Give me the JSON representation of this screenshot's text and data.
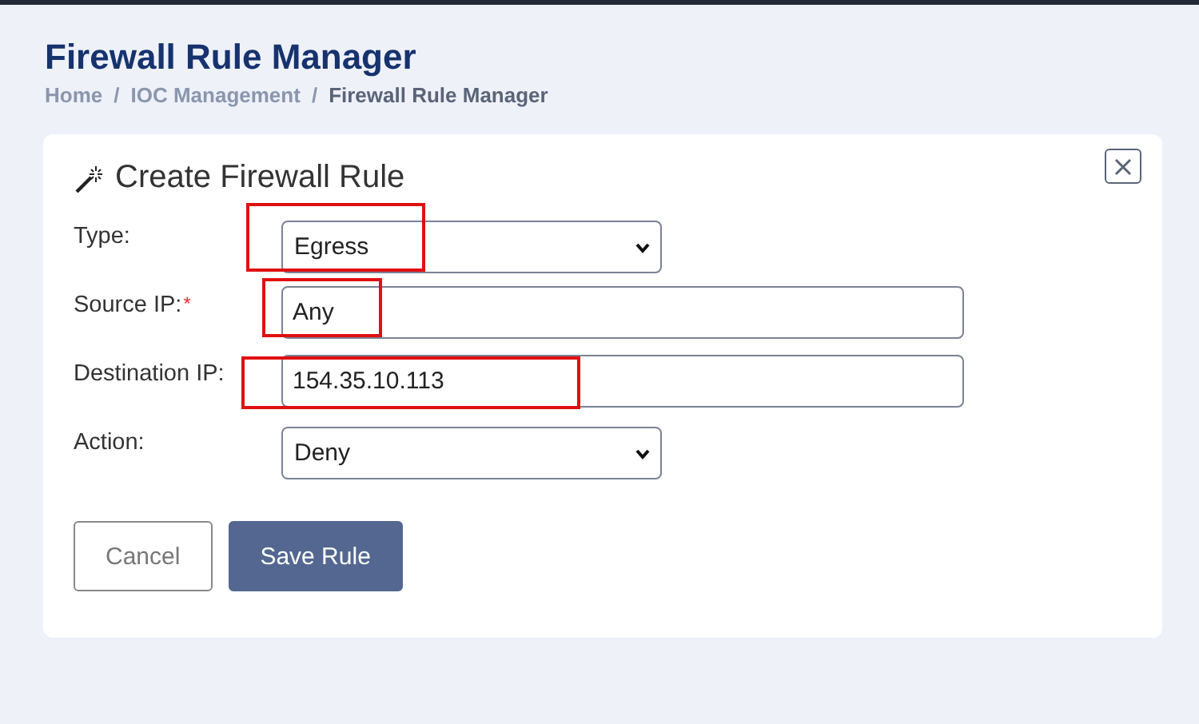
{
  "page": {
    "title": "Firewall Rule Manager"
  },
  "breadcrumb": [
    {
      "label": "Home",
      "current": false
    },
    {
      "label": "IOC Management",
      "current": false
    },
    {
      "label": "Firewall Rule Manager",
      "current": true
    }
  ],
  "breadcrumb_separators": [
    "/",
    "/"
  ],
  "dialog": {
    "title": "Create Firewall Rule",
    "required_mark": "*",
    "fields": [
      {
        "kind": "select",
        "label": "Type:",
        "required": false,
        "value": "Egress",
        "highlighted": true
      },
      {
        "kind": "text",
        "label": "Source IP:",
        "required": true,
        "value": "Any",
        "highlighted": true
      },
      {
        "kind": "text",
        "label": "Destination IP:",
        "required": false,
        "value": "154.35.10.113",
        "highlighted": true
      },
      {
        "kind": "select",
        "label": "Action:",
        "required": false,
        "value": "Deny",
        "highlighted": false
      }
    ],
    "buttons": [
      {
        "kind": "secondary",
        "label": "Cancel"
      },
      {
        "kind": "primary",
        "label": "Save Rule"
      }
    ]
  }
}
